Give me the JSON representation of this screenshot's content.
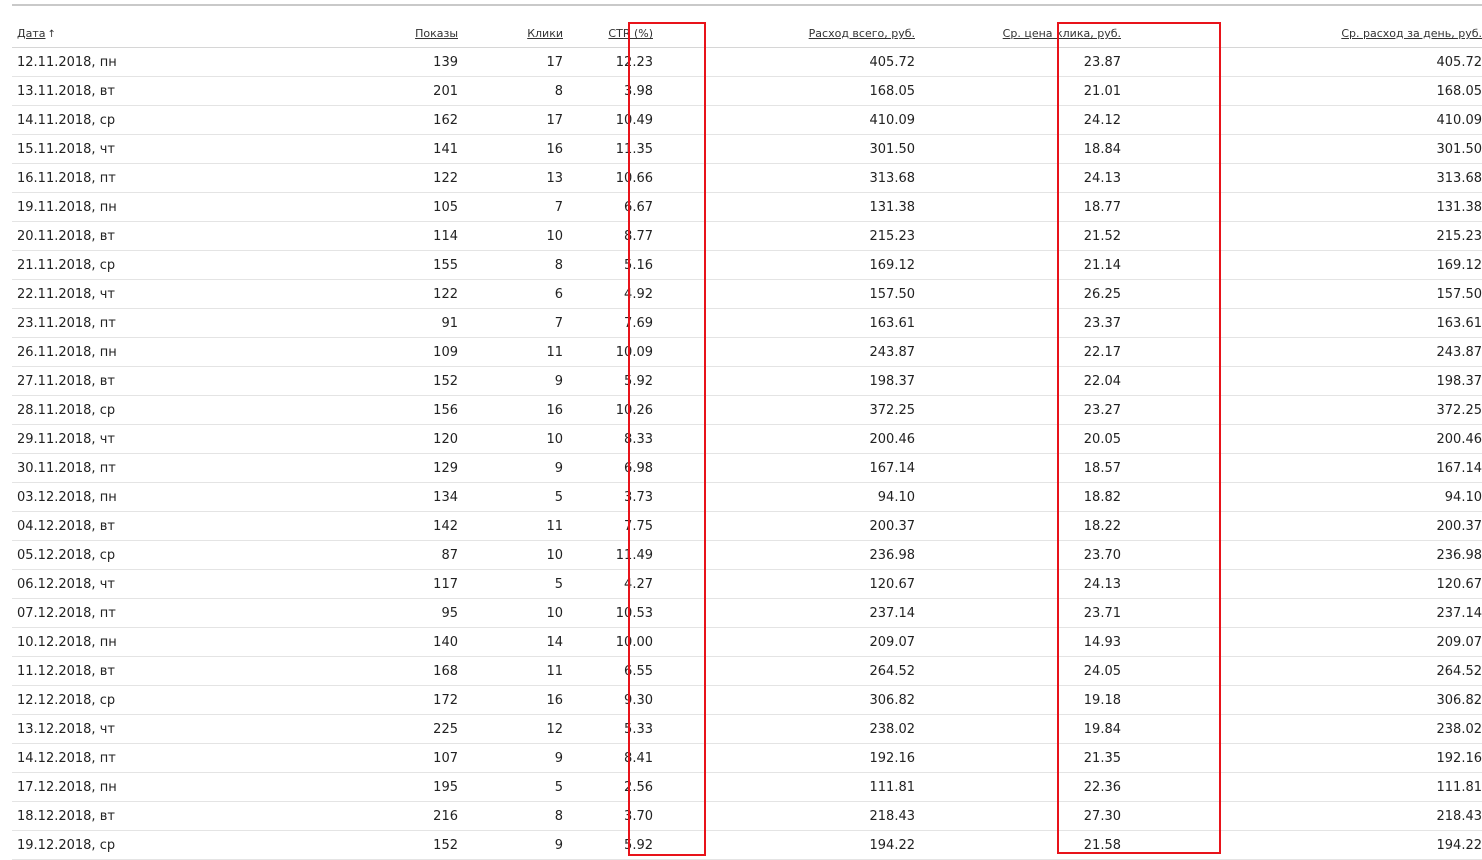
{
  "table": {
    "headers": {
      "date": "Дата",
      "date_sort_arrow": "↑",
      "impressions": "Показы",
      "clicks": "Клики",
      "ctr": "CTR (%)",
      "cost_total": "Расход всего, руб.",
      "avg_cpc": "Ср. цена клика, руб.",
      "avg_daily_cost": "Ср. расход за день, руб."
    },
    "rows": [
      {
        "date": "12.11.2018, пн",
        "impressions": "139",
        "clicks": "17",
        "ctr": "12.23",
        "cost_total": "405.72",
        "avg_cpc": "23.87",
        "avg_daily_cost": "405.72"
      },
      {
        "date": "13.11.2018, вт",
        "impressions": "201",
        "clicks": "8",
        "ctr": "3.98",
        "cost_total": "168.05",
        "avg_cpc": "21.01",
        "avg_daily_cost": "168.05"
      },
      {
        "date": "14.11.2018, ср",
        "impressions": "162",
        "clicks": "17",
        "ctr": "10.49",
        "cost_total": "410.09",
        "avg_cpc": "24.12",
        "avg_daily_cost": "410.09"
      },
      {
        "date": "15.11.2018, чт",
        "impressions": "141",
        "clicks": "16",
        "ctr": "11.35",
        "cost_total": "301.50",
        "avg_cpc": "18.84",
        "avg_daily_cost": "301.50"
      },
      {
        "date": "16.11.2018, пт",
        "impressions": "122",
        "clicks": "13",
        "ctr": "10.66",
        "cost_total": "313.68",
        "avg_cpc": "24.13",
        "avg_daily_cost": "313.68"
      },
      {
        "date": "19.11.2018, пн",
        "impressions": "105",
        "clicks": "7",
        "ctr": "6.67",
        "cost_total": "131.38",
        "avg_cpc": "18.77",
        "avg_daily_cost": "131.38"
      },
      {
        "date": "20.11.2018, вт",
        "impressions": "114",
        "clicks": "10",
        "ctr": "8.77",
        "cost_total": "215.23",
        "avg_cpc": "21.52",
        "avg_daily_cost": "215.23"
      },
      {
        "date": "21.11.2018, ср",
        "impressions": "155",
        "clicks": "8",
        "ctr": "5.16",
        "cost_total": "169.12",
        "avg_cpc": "21.14",
        "avg_daily_cost": "169.12"
      },
      {
        "date": "22.11.2018, чт",
        "impressions": "122",
        "clicks": "6",
        "ctr": "4.92",
        "cost_total": "157.50",
        "avg_cpc": "26.25",
        "avg_daily_cost": "157.50"
      },
      {
        "date": "23.11.2018, пт",
        "impressions": "91",
        "clicks": "7",
        "ctr": "7.69",
        "cost_total": "163.61",
        "avg_cpc": "23.37",
        "avg_daily_cost": "163.61"
      },
      {
        "date": "26.11.2018, пн",
        "impressions": "109",
        "clicks": "11",
        "ctr": "10.09",
        "cost_total": "243.87",
        "avg_cpc": "22.17",
        "avg_daily_cost": "243.87"
      },
      {
        "date": "27.11.2018, вт",
        "impressions": "152",
        "clicks": "9",
        "ctr": "5.92",
        "cost_total": "198.37",
        "avg_cpc": "22.04",
        "avg_daily_cost": "198.37"
      },
      {
        "date": "28.11.2018, ср",
        "impressions": "156",
        "clicks": "16",
        "ctr": "10.26",
        "cost_total": "372.25",
        "avg_cpc": "23.27",
        "avg_daily_cost": "372.25"
      },
      {
        "date": "29.11.2018, чт",
        "impressions": "120",
        "clicks": "10",
        "ctr": "8.33",
        "cost_total": "200.46",
        "avg_cpc": "20.05",
        "avg_daily_cost": "200.46"
      },
      {
        "date": "30.11.2018, пт",
        "impressions": "129",
        "clicks": "9",
        "ctr": "6.98",
        "cost_total": "167.14",
        "avg_cpc": "18.57",
        "avg_daily_cost": "167.14"
      },
      {
        "date": "03.12.2018, пн",
        "impressions": "134",
        "clicks": "5",
        "ctr": "3.73",
        "cost_total": "94.10",
        "avg_cpc": "18.82",
        "avg_daily_cost": "94.10"
      },
      {
        "date": "04.12.2018, вт",
        "impressions": "142",
        "clicks": "11",
        "ctr": "7.75",
        "cost_total": "200.37",
        "avg_cpc": "18.22",
        "avg_daily_cost": "200.37"
      },
      {
        "date": "05.12.2018, ср",
        "impressions": "87",
        "clicks": "10",
        "ctr": "11.49",
        "cost_total": "236.98",
        "avg_cpc": "23.70",
        "avg_daily_cost": "236.98"
      },
      {
        "date": "06.12.2018, чт",
        "impressions": "117",
        "clicks": "5",
        "ctr": "4.27",
        "cost_total": "120.67",
        "avg_cpc": "24.13",
        "avg_daily_cost": "120.67"
      },
      {
        "date": "07.12.2018, пт",
        "impressions": "95",
        "clicks": "10",
        "ctr": "10.53",
        "cost_total": "237.14",
        "avg_cpc": "23.71",
        "avg_daily_cost": "237.14"
      },
      {
        "date": "10.12.2018, пн",
        "impressions": "140",
        "clicks": "14",
        "ctr": "10.00",
        "cost_total": "209.07",
        "avg_cpc": "14.93",
        "avg_daily_cost": "209.07"
      },
      {
        "date": "11.12.2018, вт",
        "impressions": "168",
        "clicks": "11",
        "ctr": "6.55",
        "cost_total": "264.52",
        "avg_cpc": "24.05",
        "avg_daily_cost": "264.52"
      },
      {
        "date": "12.12.2018, ср",
        "impressions": "172",
        "clicks": "16",
        "ctr": "9.30",
        "cost_total": "306.82",
        "avg_cpc": "19.18",
        "avg_daily_cost": "306.82"
      },
      {
        "date": "13.12.2018, чт",
        "impressions": "225",
        "clicks": "12",
        "ctr": "5.33",
        "cost_total": "238.02",
        "avg_cpc": "19.84",
        "avg_daily_cost": "238.02"
      },
      {
        "date": "14.12.2018, пт",
        "impressions": "107",
        "clicks": "9",
        "ctr": "8.41",
        "cost_total": "192.16",
        "avg_cpc": "21.35",
        "avg_daily_cost": "192.16"
      },
      {
        "date": "17.12.2018, пн",
        "impressions": "195",
        "clicks": "5",
        "ctr": "2.56",
        "cost_total": "111.81",
        "avg_cpc": "22.36",
        "avg_daily_cost": "111.81"
      },
      {
        "date": "18.12.2018, вт",
        "impressions": "216",
        "clicks": "8",
        "ctr": "3.70",
        "cost_total": "218.43",
        "avg_cpc": "27.30",
        "avg_daily_cost": "218.43"
      },
      {
        "date": "19.12.2018, ср",
        "impressions": "152",
        "clicks": "9",
        "ctr": "5.92",
        "cost_total": "194.22",
        "avg_cpc": "21.58",
        "avg_daily_cost": "194.22"
      }
    ]
  },
  "highlight_color": "#e8131a"
}
